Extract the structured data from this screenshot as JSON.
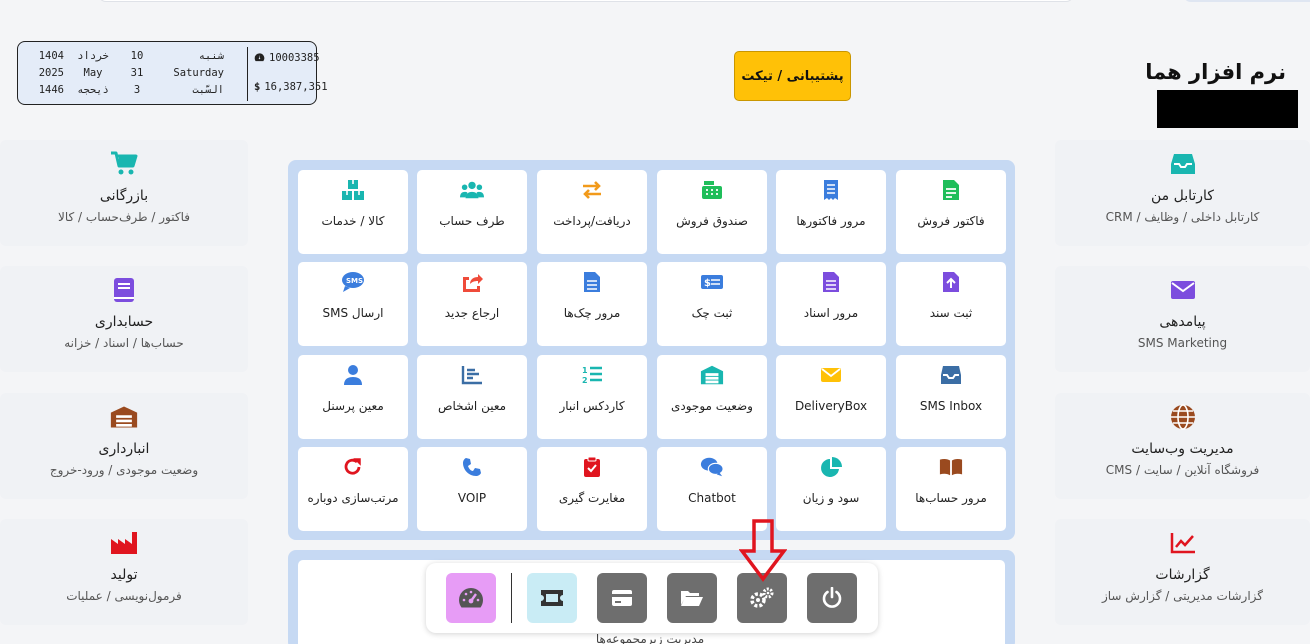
{
  "header": {
    "brand": "نرم افزار هما",
    "ticket_button": "پشتیبانی / تیکت",
    "dates": [
      {
        "year": "1404",
        "month": "خرداد",
        "day": "10",
        "weekday": "شنبه"
      },
      {
        "year": "2025",
        "month": "May",
        "day": "31",
        "weekday": "Saturday"
      },
      {
        "year": "1446",
        "month": "ذیحجه",
        "day": "3",
        "weekday": "السّبت"
      }
    ],
    "stats": {
      "counter": "10003385",
      "balance": "16,387,351"
    }
  },
  "colors": {
    "accent": "#ffc107",
    "panel": "#c6d9f3",
    "green": "#1fbe5a",
    "teal": "#19b6b0",
    "purple": "#7c4dde",
    "blue": "#3b7ddd",
    "red": "#e0151f",
    "brown": "#9a4a1f",
    "orange": "#f29a1a"
  },
  "left_cards": [
    {
      "title": "بازرگانی",
      "sub": "فاکتور / طرف‌حساب / کالا",
      "icon": "shopping-cart-icon"
    },
    {
      "title": "حسابداری",
      "sub": "حساب‌ها / اسناد / خزانه",
      "icon": "book-icon"
    },
    {
      "title": "انبارداری",
      "sub": "وضعیت موجودی / ورود-خروج",
      "icon": "warehouse-icon"
    },
    {
      "title": "تولید",
      "sub": "فرمول‌نویسی / عملیات",
      "icon": "factory-icon"
    }
  ],
  "right_cards": [
    {
      "title": "کارتابل من",
      "sub": "کارتابل داخلی / وظایف / CRM",
      "icon": "inbox-icon"
    },
    {
      "title": "پیامدهی",
      "sub": "SMS Marketing",
      "icon": "envelope-icon"
    },
    {
      "title": "مدیریت وب‌سایت",
      "sub": "فروشگاه آنلاین / سایت / CMS",
      "icon": "globe-icon"
    },
    {
      "title": "گزارشات",
      "sub": "گزارشات مدیریتی / گزارش ساز",
      "icon": "chart-line-icon"
    }
  ],
  "tiles": [
    [
      "فاکتور فروش",
      "مرور فاکتورها",
      "صندوق فروش",
      "دریافت/پرداخت",
      "طرف حساب",
      "کالا / خدمات"
    ],
    [
      "ثبت سند",
      "مرور اسناد",
      "ثبت چک",
      "مرور چک‌ها",
      "ارجاع جدید",
      "ارسال SMS"
    ],
    [
      "SMS Inbox",
      "DeliveryBox",
      "وضعیت موجودی",
      "کاردکس انبار",
      "معین اشخاص",
      "معین پرسنل"
    ],
    [
      "مرور حساب‌ها",
      "سود و زیان",
      "Chatbot",
      "مغایرت گیری",
      "VOIP",
      "مرتب‌سازی دوباره"
    ]
  ],
  "lower": {
    "label": "مدیریت زیرمجموعه‌ها"
  },
  "dock": [
    "power-icon",
    "gears-icon",
    "folder-open-icon",
    "credit-card-icon",
    "ticket-icon",
    "gauge-icon"
  ]
}
